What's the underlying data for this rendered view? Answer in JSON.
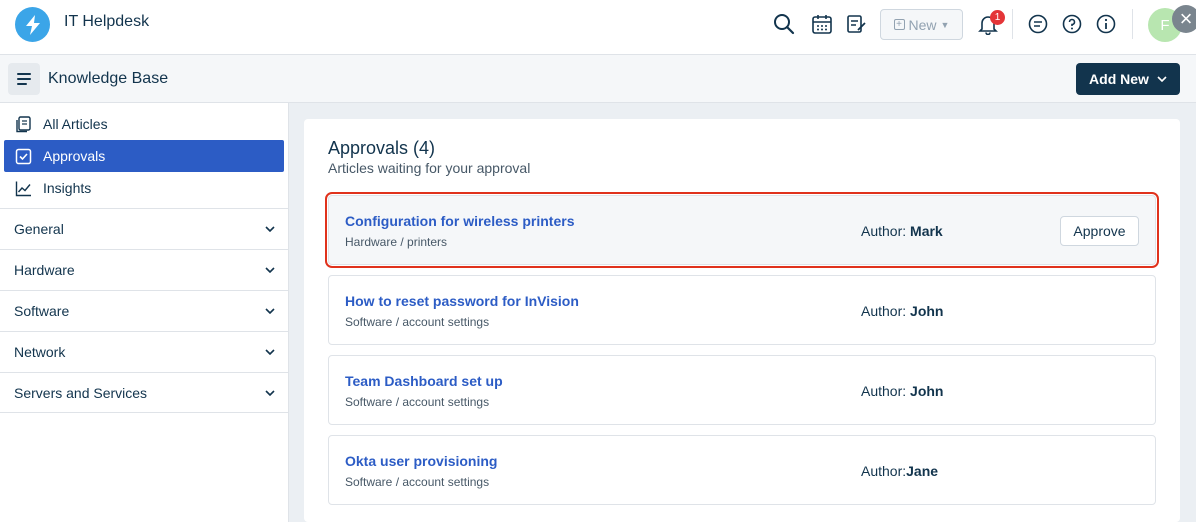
{
  "app": {
    "title": "IT Helpdesk"
  },
  "topbar": {
    "new_label": "New",
    "notification_count": "1",
    "avatar_initial": "F"
  },
  "header": {
    "title": "Knowledge Base",
    "add_new_label": "Add New"
  },
  "sidebar": {
    "links": [
      {
        "label": "All Articles",
        "icon": "articles-icon"
      },
      {
        "label": "Approvals",
        "icon": "approval-check-icon"
      },
      {
        "label": "Insights",
        "icon": "insights-chart-icon"
      }
    ],
    "categories": [
      {
        "label": "General"
      },
      {
        "label": "Hardware"
      },
      {
        "label": "Software"
      },
      {
        "label": "Network"
      },
      {
        "label": "Servers and Services"
      }
    ]
  },
  "main": {
    "title": "Approvals (4)",
    "subtitle": "Articles waiting for your approval",
    "approve_label": "Approve",
    "articles": [
      {
        "title": "Configuration for wireless printers",
        "path": "Hardware / printers",
        "author_label": "Author: ",
        "author": "Mark"
      },
      {
        "title": "How to reset password for InVision",
        "path": "Software / account settings",
        "author_label": "Author: ",
        "author": "John"
      },
      {
        "title": "Team Dashboard set up",
        "path": "Software / account settings",
        "author_label": "Author: ",
        "author": "John"
      },
      {
        "title": "Okta user provisioning",
        "path": "Software / account settings",
        "author_label": "Author:",
        "author": "Jane"
      }
    ]
  },
  "colors": {
    "primary": "#2c5cc5",
    "navy": "#12344d",
    "highlight_border": "#e0321c",
    "badge": "#e43538",
    "logo": "#3ba5e8"
  }
}
